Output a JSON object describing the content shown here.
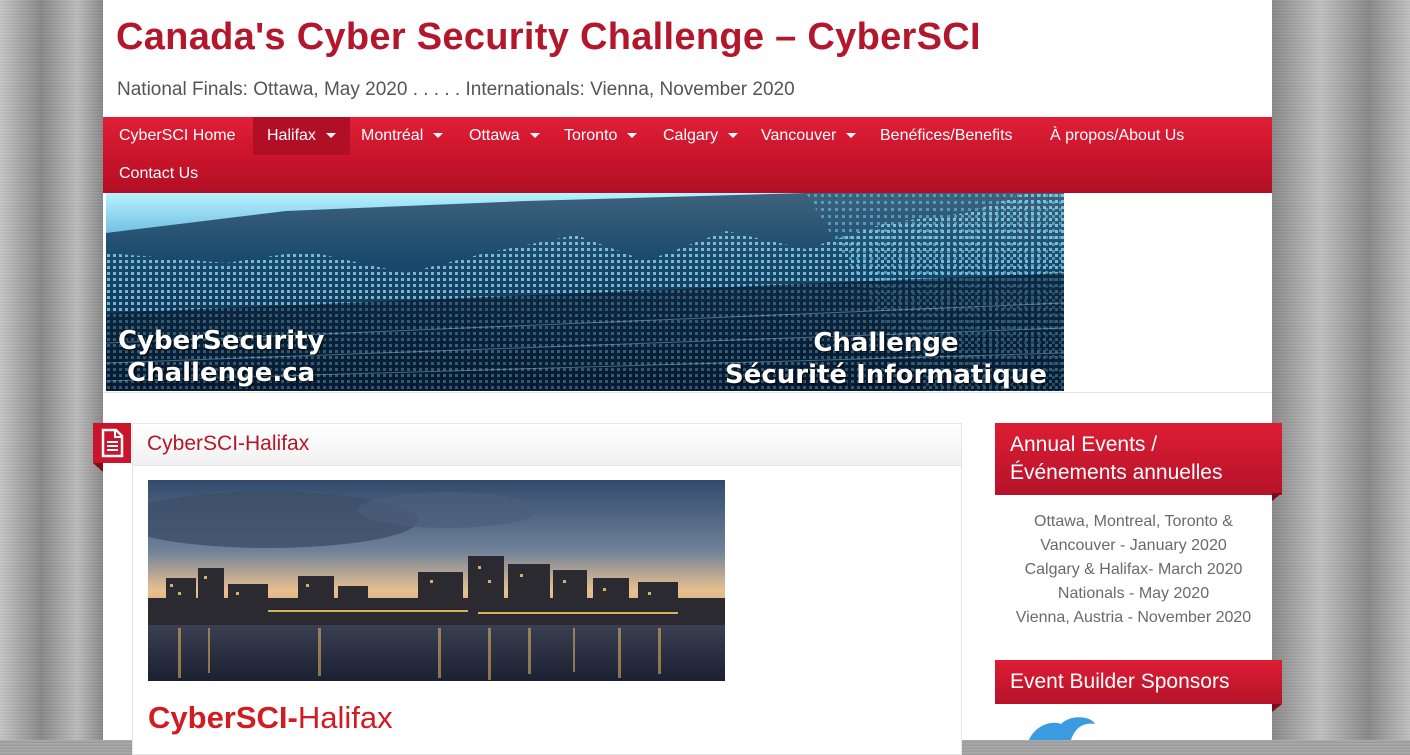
{
  "site": {
    "title": "Canada's Cyber Security Challenge – CyberSCI",
    "description": "National Finals: Ottawa, May 2020 . . . . . Internationals: Vienna, November 2020"
  },
  "nav": {
    "items": [
      {
        "label": "CyberSCI Home",
        "dropdown": false
      },
      {
        "label": "Halifax",
        "dropdown": true,
        "active": true
      },
      {
        "label": "Montréal",
        "dropdown": true
      },
      {
        "label": "Ottawa",
        "dropdown": true
      },
      {
        "label": "Toronto",
        "dropdown": true
      },
      {
        "label": "Calgary",
        "dropdown": true
      },
      {
        "label": "Vancouver",
        "dropdown": true
      },
      {
        "label": "Benéfices/Benefits",
        "dropdown": false
      },
      {
        "label": "À propos/About Us",
        "dropdown": false
      },
      {
        "label": "Contact Us",
        "dropdown": false
      }
    ]
  },
  "banner": {
    "text_left_line1": "CyberSecurity",
    "text_left_line2": "Challenge.ca",
    "text_right_line1": "Challenge",
    "text_right_line2": "Sécurité Informatique"
  },
  "article": {
    "entry_title": "CyberSCI-Halifax",
    "icon": "document-icon",
    "heading_bold": "CyberSCI-",
    "heading_rest": "Halifax"
  },
  "sidebar": {
    "annual_events": {
      "title_line1": "Annual Events /",
      "title_line2": "Événements annuelles",
      "lines": [
        "Ottawa, Montreal, Toronto &",
        "Vancouver - January 2020",
        "Calgary & Halifax- March 2020",
        "Nationals - May 2020",
        "Vienna, Austria - November 2020"
      ]
    },
    "sponsors": {
      "title": "Event Builder Sponsors"
    }
  },
  "colors": {
    "brand_red": "#b3172c",
    "nav_red": "#d0182f",
    "heading_red": "#d11d22"
  }
}
